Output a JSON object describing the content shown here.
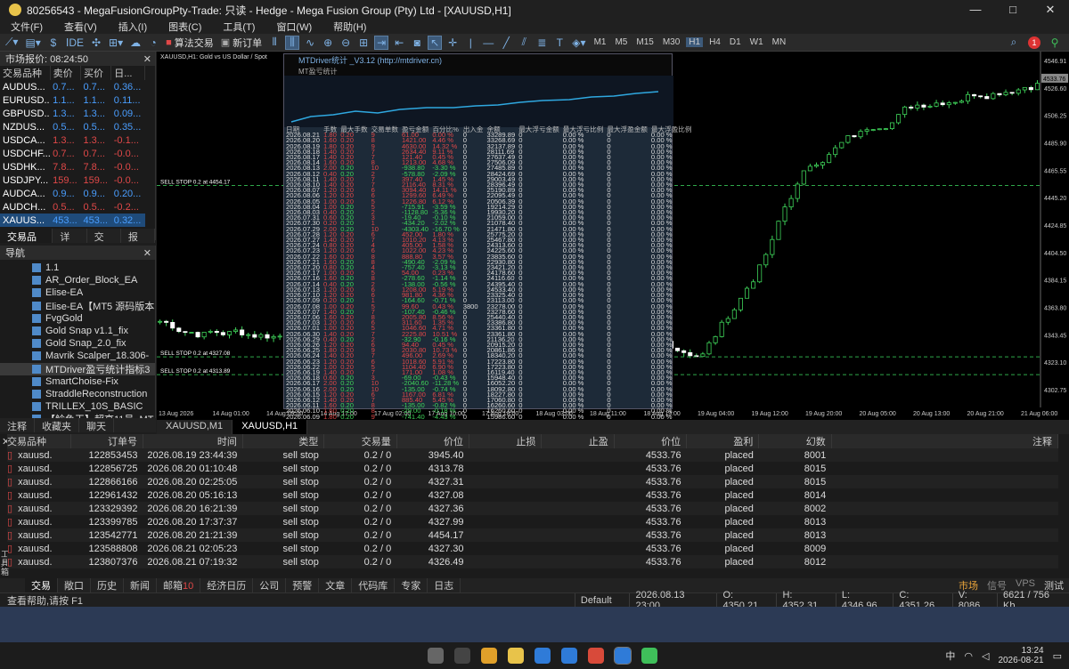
{
  "window": {
    "title": "80256543 - MegaFusionGroupPty-Trade: 只读 - Hedge - Mega Fusion Group (Pty) Ltd - [XAUUSD,H1]"
  },
  "menu": [
    "文件(F)",
    "查看(V)",
    "插入(I)",
    "图表(C)",
    "工具(T)",
    "窗口(W)",
    "帮助(H)"
  ],
  "toolbar": {
    "algo": "算法交易",
    "new_order": "新订单",
    "timeframes": [
      "M1",
      "M5",
      "M15",
      "M30",
      "H1",
      "H4",
      "D1",
      "W1",
      "MN"
    ],
    "active_tf": "H1",
    "notif": "1"
  },
  "market_watch": {
    "title": "市场报价: 08:24:50",
    "headers": [
      "交易品种",
      "卖价",
      "买价",
      "日..."
    ],
    "rows": [
      {
        "sym": "AUDUS...",
        "bid": "0.7...",
        "ask": "0.7...",
        "chg": "0.36..."
      },
      {
        "sym": "EURUSD...",
        "bid": "1.1...",
        "ask": "1.1...",
        "chg": "0.11..."
      },
      {
        "sym": "GBPUSD...",
        "bid": "1.3...",
        "ask": "1.3...",
        "chg": "0.09..."
      },
      {
        "sym": "NZDUS...",
        "bid": "0.5...",
        "ask": "0.5...",
        "chg": "0.35..."
      },
      {
        "sym": "USDCA...",
        "bid": "1.3...",
        "ask": "1.3...",
        "chg": "-0.1..."
      },
      {
        "sym": "USDCHF...",
        "bid": "0.7...",
        "ask": "0.7...",
        "chg": "-0.0..."
      },
      {
        "sym": "USDHK...",
        "bid": "7.8...",
        "ask": "7.8...",
        "chg": "-0.0..."
      },
      {
        "sym": "USDJPY...",
        "bid": "159...",
        "ask": "159...",
        "chg": "-0.0..."
      },
      {
        "sym": "AUDCA...",
        "bid": "0.9...",
        "ask": "0.9...",
        "chg": "0.20..."
      },
      {
        "sym": "AUDCH...",
        "bid": "0.5...",
        "ask": "0.5...",
        "chg": "-0.2..."
      },
      {
        "sym": "XAUUS...",
        "bid": "453...",
        "ask": "453...",
        "chg": "0.32..."
      }
    ],
    "tabs": [
      "交易品种",
      "详细",
      "交易",
      "报价"
    ]
  },
  "navigator": {
    "title": "导航",
    "items": [
      "1.1",
      "AR_Order_Block_EA",
      "Elise-EA",
      "Elise-EA【MT5 源码版本",
      "FvgGold",
      "Gold Snap v1.1_fix",
      "Gold Snap_2.0_fix",
      "Mavrik Scalper_18.306-",
      "MTDriver盈亏统计指标3",
      "SmartChoise-Fix",
      "StraddleReconstruction",
      "TRILLEX_10S_BASIC",
      "【鲶鱼王】超高11号_MT"
    ],
    "tabs": [
      "注释",
      "收藏夹",
      "聊天"
    ]
  },
  "chart": {
    "label": "XAUUSD,H1:  Gold vs US Dollar / Spot",
    "price_tag": "4533.76",
    "price_levels": [
      "4546.91",
      "4526.60",
      "4506.25",
      "4485.90",
      "4465.55",
      "4445.20",
      "4424.85",
      "4404.50",
      "4384.15",
      "4363.80",
      "4343.45",
      "4323.10",
      "4302.75"
    ],
    "time_labels": [
      "13 Aug 2026",
      "14 Aug 01:00",
      "14 Aug 09:00",
      "14 Aug 17:00",
      "17 Aug 02:00",
      "17 Aug 10:00",
      "17 Aug 18:00",
      "18 Aug 03:00",
      "18 Aug 11:00",
      "18 Aug 19:00",
      "19 Aug 04:00",
      "19 Aug 12:00",
      "19 Aug 20:00",
      "20 Aug 05:00",
      "20 Aug 13:00",
      "20 Aug 21:00",
      "21 Aug 06:00"
    ],
    "order_lines": [
      "SELL STOP 0.2 at 4454.17",
      "SELL STOP 0.2 at 4327.08",
      "SELL STOP 0.2 at 4313.89"
    ],
    "tabs": [
      "XAUUSD,M1",
      "XAUUSD,H1"
    ]
  },
  "mtdriver": {
    "title": "MTDriver统计 _V3.12 (http://mtdriver.cn)",
    "sub": "MT盈亏统计",
    "headers": [
      "日期",
      "手数",
      "最大手数",
      "交易单数",
      "盈亏金额",
      "百分比%",
      "出入金",
      "余额",
      "最大浮亏金额",
      "最大浮亏比例",
      "最大浮盈金额",
      "最大浮盈比例"
    ],
    "rows": [
      [
        "2026.08.21",
        "1.80",
        "0.20",
        "9",
        "61.00",
        "0.00 %",
        "0",
        "33289.89",
        "0",
        "0.00 %",
        "0",
        "0.00 %"
      ],
      [
        "2026.08.20",
        "1.60",
        "0.20",
        "8",
        "1421.00",
        "4.46 %",
        "0",
        "33268.69",
        "0",
        "0.00 %",
        "0",
        "0.00 %"
      ],
      [
        "2026.08.19",
        "1.80",
        "0.20",
        "9",
        "4630.00",
        "14.32 %",
        "0",
        "32137.89",
        "0",
        "0.00 %",
        "0",
        "0.00 %"
      ],
      [
        "2026.08.18",
        "1.40",
        "0.20",
        "7",
        "2634.40",
        "9.11 %",
        "0",
        "28111.69",
        "0",
        "0.00 %",
        "0",
        "0.00 %"
      ],
      [
        "2026.08.17",
        "1.40",
        "0.20",
        "7",
        "121.40",
        "0.45 %",
        "0",
        "27637.49",
        "0",
        "0.00 %",
        "0",
        "0.00 %"
      ],
      [
        "2026.08.14",
        "1.60",
        "0.20",
        "8",
        "1213.00",
        "4.68 %",
        "0",
        "27506.09",
        "0",
        "0.00 %",
        "0",
        "0.00 %"
      ],
      [
        "2026.08.13",
        "2.00",
        "0.20",
        "10",
        "-938.80",
        "-3.30 %",
        "0",
        "27485.89",
        "0",
        "0.00 %",
        "0",
        "0.00 %"
      ],
      [
        "2026.08.12",
        "0.40",
        "0.20",
        "2",
        "-578.80",
        "-2.09 %",
        "0",
        "28424.69",
        "0",
        "0.00 %",
        "0",
        "0.00 %"
      ],
      [
        "2026.08.11",
        "1.40",
        "0.20",
        "7",
        "397.40",
        "1.45 %",
        "0",
        "29003.49",
        "0",
        "0.00 %",
        "0",
        "0.00 %"
      ],
      [
        "2026.08.10",
        "1.40",
        "0.20",
        "7",
        "2116.40",
        "8.31 %",
        "0",
        "28396.49",
        "0",
        "0.00 %",
        "0",
        "0.00 %"
      ],
      [
        "2026.08.07",
        "1.20",
        "0.20",
        "6",
        "3094.40",
        "14.11 %",
        "0",
        "25190.89",
        "0",
        "0.00 %",
        "0",
        "0.00 %"
      ],
      [
        "2026.08.06",
        "1.20",
        "0.20",
        "6",
        "1299.60",
        "6.49 %",
        "0",
        "22095.49",
        "0",
        "0.00 %",
        "0",
        "0.00 %"
      ],
      [
        "2026.08.05",
        "1.00",
        "0.20",
        "5",
        "1226.80",
        "6.12 %",
        "0",
        "20506.39",
        "0",
        "0.00 %",
        "0",
        "0.00 %"
      ],
      [
        "2026.08.04",
        "1.00",
        "0.20",
        "5",
        "-715.91",
        "-3.59 %",
        "0",
        "19214.29",
        "0",
        "0.00 %",
        "0",
        "0.00 %"
      ],
      [
        "2026.08.03",
        "0.40",
        "0.20",
        "2",
        "-1128.80",
        "-5.36 %",
        "0",
        "19930.20",
        "0",
        "0.00 %",
        "0",
        "0.00 %"
      ],
      [
        "2026.07.31",
        "0.60",
        "0.20",
        "3",
        "-19.40",
        "-0.10 %",
        "0",
        "21059.00",
        "0",
        "0.00 %",
        "0",
        "0.00 %"
      ],
      [
        "2026.07.30",
        "0.20",
        "0.20",
        "1",
        "-434.20",
        "-2.02 %",
        "0",
        "21078.40",
        "0",
        "0.00 %",
        "0",
        "0.00 %"
      ],
      [
        "2026.07.29",
        "2.00",
        "0.20",
        "10",
        "-4303.40",
        "-16.70 %",
        "0",
        "21471.80",
        "0",
        "0.00 %",
        "0",
        "0.00 %"
      ],
      [
        "2026.07.28",
        "1.20",
        "0.20",
        "6",
        "452.00",
        "1.80 %",
        "0",
        "25775.20",
        "0",
        "0.00 %",
        "0",
        "0.00 %"
      ],
      [
        "2026.07.27",
        "1.40",
        "0.20",
        "7",
        "1010.20",
        "4.13 %",
        "0",
        "25467.80",
        "0",
        "0.00 %",
        "0",
        "0.00 %"
      ],
      [
        "2026.07.24",
        "0.80",
        "0.20",
        "4",
        "405.00",
        "1.58 %",
        "0",
        "24313.60",
        "0",
        "0.00 %",
        "0",
        "0.00 %"
      ],
      [
        "2026.07.23",
        "1.20",
        "0.20",
        "6",
        "1022.00",
        "4.23 %",
        "0",
        "24225.60",
        "0",
        "0.00 %",
        "0",
        "0.00 %"
      ],
      [
        "2026.07.22",
        "1.60",
        "0.20",
        "8",
        "888.80",
        "3.57 %",
        "0",
        "23835.60",
        "0",
        "0.00 %",
        "0",
        "0.00 %"
      ],
      [
        "2026.07.21",
        "1.60",
        "0.20",
        "8",
        "-490.40",
        "-2.09 %",
        "0",
        "22930.80",
        "0",
        "0.00 %",
        "0",
        "0.00 %"
      ],
      [
        "2026.07.20",
        "0.80",
        "0.20",
        "4",
        "-757.40",
        "-3.13 %",
        "0",
        "23421.20",
        "0",
        "0.00 %",
        "0",
        "0.00 %"
      ],
      [
        "2026.07.17",
        "1.00",
        "0.20",
        "5",
        "54.00",
        "0.23 %",
        "0",
        "24178.60",
        "0",
        "0.00 %",
        "0",
        "0.00 %"
      ],
      [
        "2026.07.16",
        "1.60",
        "0.20",
        "8",
        "-278.60",
        "-1.14 %",
        "0",
        "24116.60",
        "0",
        "0.00 %",
        "0",
        "0.00 %"
      ],
      [
        "2026.07.14",
        "0.40",
        "0.20",
        "2",
        "-138.00",
        "-0.56 %",
        "0",
        "24395.40",
        "0",
        "0.00 %",
        "0",
        "0.00 %"
      ],
      [
        "2026.07.13",
        "1.20",
        "0.20",
        "6",
        "1208.00",
        "5.19 %",
        "0",
        "24533.40",
        "0",
        "0.00 %",
        "0",
        "0.00 %"
      ],
      [
        "2026.07.10",
        "1.20",
        "0.20",
        "6",
        "981.80",
        "4.36 %",
        "0",
        "23325.40",
        "0",
        "0.00 %",
        "0",
        "0.00 %"
      ],
      [
        "2026.07.09",
        "0.20",
        "0.20",
        "1",
        "-164.60",
        "-0.71 %",
        "0",
        "23113.00",
        "0",
        "0.00 %",
        "0",
        "0.00 %"
      ],
      [
        "2026.07.08",
        "1.00",
        "0.20",
        "5",
        "99.60",
        "0.43 %",
        "3800",
        "23278.00",
        "0",
        "0.00 %",
        "0",
        "0.00 %"
      ],
      [
        "2026.07.07",
        "1.40",
        "0.20",
        "7",
        "-107.40",
        "-0.46 %",
        "0",
        "23278.60",
        "0",
        "0.00 %",
        "0",
        "0.00 %"
      ],
      [
        "2026.07.06",
        "1.60",
        "0.20",
        "8",
        "2005.80",
        "8.56 %",
        "0",
        "25440.40",
        "0",
        "0.00 %",
        "0",
        "0.00 %"
      ],
      [
        "2026.07.03",
        "1.20",
        "0.20",
        "6",
        "311.60",
        "1.35 %",
        "0",
        "23386.80",
        "0",
        "0.00 %",
        "0",
        "0.00 %"
      ],
      [
        "2026.07.01",
        "1.00",
        "0.20",
        "5",
        "1046.60",
        "4.71 %",
        "0",
        "23361.80",
        "0",
        "0.00 %",
        "0",
        "0.00 %"
      ],
      [
        "2026.06.30",
        "1.40",
        "0.20",
        "7",
        "2225.80",
        "10.51 %",
        "0",
        "23361.80",
        "0",
        "0.00 %",
        "0",
        "0.00 %"
      ],
      [
        "2026.06.29",
        "0.40",
        "0.20",
        "2",
        "-32.90",
        "-0.16 %",
        "0",
        "21136.20",
        "0",
        "0.00 %",
        "0",
        "0.00 %"
      ],
      [
        "2026.06.26",
        "1.20",
        "0.20",
        "6",
        "94.40",
        "0.45 %",
        "0",
        "20915.20",
        "0",
        "0.00 %",
        "0",
        "0.00 %"
      ],
      [
        "2026.06.25",
        "1.80",
        "0.20",
        "9",
        "2030.80",
        "10.73 %",
        "0",
        "20861.86",
        "0",
        "0.00 %",
        "0",
        "0.00 %"
      ],
      [
        "2026.06.24",
        "1.40",
        "0.20",
        "7",
        "496.00",
        "2.69 %",
        "0",
        "18340.20",
        "0",
        "0.00 %",
        "0",
        "0.00 %"
      ],
      [
        "2026.06.23",
        "1.20",
        "0.20",
        "6",
        "1018.60",
        "5.91 %",
        "0",
        "17223.80",
        "0",
        "0.00 %",
        "0",
        "0.00 %"
      ],
      [
        "2026.06.22",
        "1.00",
        "0.20",
        "5",
        "1104.40",
        "6.90 %",
        "0",
        "17223.80",
        "0",
        "0.00 %",
        "0",
        "0.00 %"
      ],
      [
        "2026.06.19",
        "1.40",
        "0.20",
        "7",
        "171.00",
        "1.08 %",
        "0",
        "16119.40",
        "0",
        "0.00 %",
        "0",
        "0.00 %"
      ],
      [
        "2026.06.18",
        "0.60",
        "0.20",
        "3",
        "-69.00",
        "-0.43 %",
        "0",
        "15948.40",
        "0",
        "0.00 %",
        "0",
        "0.00 %"
      ],
      [
        "2026.06.17",
        "2.00",
        "0.20",
        "10",
        "-2040.60",
        "-11.28 %",
        "0",
        "16052.20",
        "0",
        "0.00 %",
        "0",
        "0.00 %"
      ],
      [
        "2026.06.16",
        "2.00",
        "0.20",
        "10",
        "-135.00",
        "-0.74 %",
        "0",
        "18092.80",
        "0",
        "0.00 %",
        "0",
        "0.00 %"
      ],
      [
        "2026.06.15",
        "1.20",
        "0.20",
        "6",
        "1167.00",
        "6.81 %",
        "0",
        "18227.80",
        "0",
        "0.00 %",
        "0",
        "0.00 %"
      ],
      [
        "2026.06.12",
        "1.40",
        "0.20",
        "7",
        "885.40",
        "5.45 %",
        "0",
        "17060.80",
        "0",
        "0.00 %",
        "0",
        "0.00 %"
      ],
      [
        "2026.06.11",
        "1.60",
        "0.20",
        "8",
        "-135.00",
        "-0.82 %",
        "0",
        "16260.60",
        "0",
        "0.00 %",
        "0",
        "0.00 %"
      ],
      [
        "2026.06.10",
        "1.60",
        "0.20",
        "8",
        "-29.00",
        "-0.18 %",
        "0",
        "16260.60",
        "0",
        "0.00 %",
        "0",
        "0.00 %"
      ],
      [
        "2026.06.09",
        "1.80",
        "0.20",
        "9",
        "-741.40",
        "-4.43 %",
        "0",
        "15986.60",
        "0",
        "0.00 %",
        "0",
        "0.00 %"
      ]
    ]
  },
  "terminal": {
    "headers": [
      "交易品种",
      "订单号",
      "时间",
      "类型",
      "交易量",
      "价位",
      "止损",
      "止盈",
      "价位",
      "盈利",
      "幻数",
      "注释"
    ],
    "rows": [
      [
        "xauusd.",
        "122853453",
        "2026.08.19 23:44:39",
        "sell stop",
        "0.2 / 0",
        "3945.40",
        "",
        "",
        "4533.76",
        "placed",
        "8001",
        ""
      ],
      [
        "xauusd.",
        "122856725",
        "2026.08.20 01:10:48",
        "sell stop",
        "0.2 / 0",
        "4313.78",
        "",
        "",
        "4533.76",
        "placed",
        "8015",
        ""
      ],
      [
        "xauusd.",
        "122866166",
        "2026.08.20 02:25:05",
        "sell stop",
        "0.2 / 0",
        "4327.31",
        "",
        "",
        "4533.76",
        "placed",
        "8015",
        ""
      ],
      [
        "xauusd.",
        "122961432",
        "2026.08.20 05:16:13",
        "sell stop",
        "0.2 / 0",
        "4327.08",
        "",
        "",
        "4533.76",
        "placed",
        "8014",
        ""
      ],
      [
        "xauusd.",
        "123329392",
        "2026.08.20 16:21:39",
        "sell stop",
        "0.2 / 0",
        "4327.36",
        "",
        "",
        "4533.76",
        "placed",
        "8002",
        ""
      ],
      [
        "xauusd.",
        "123399785",
        "2026.08.20 17:37:37",
        "sell stop",
        "0.2 / 0",
        "4327.99",
        "",
        "",
        "4533.76",
        "placed",
        "8013",
        ""
      ],
      [
        "xauusd.",
        "123542771",
        "2026.08.20 21:21:39",
        "sell stop",
        "0.2 / 0",
        "4454.17",
        "",
        "",
        "4533.76",
        "placed",
        "8013",
        ""
      ],
      [
        "xauusd.",
        "123588808",
        "2026.08.21 02:05:23",
        "sell stop",
        "0.2 / 0",
        "4327.30",
        "",
        "",
        "4533.76",
        "placed",
        "8009",
        ""
      ],
      [
        "xauusd.",
        "123807376",
        "2026.08.21 07:19:32",
        "sell stop",
        "0.2 / 0",
        "4326.49",
        "",
        "",
        "4533.76",
        "placed",
        "8012",
        ""
      ]
    ],
    "tabs": [
      "交易",
      "敞口",
      "历史",
      "新闻",
      "邮箱",
      "经济日历",
      "公司",
      "预警",
      "文章",
      "代码库",
      "专家",
      "日志"
    ],
    "mail_badge": "10",
    "right": [
      "市场",
      "信号",
      "VPS",
      "测试"
    ],
    "side_label": "工具箱"
  },
  "status": {
    "help": "查看帮助,请按 F1",
    "profile": "Default",
    "time": "2026.08.13 23:00",
    "open": "O: 4350.21",
    "high": "H: 4352.31",
    "low": "L: 4346.96",
    "close": "C: 4351.26",
    "volume": "V: 8086",
    "traffic": "6621 / 756 Kb"
  },
  "taskbar": {
    "time": "13:24",
    "date": "2026-08-21",
    "ime": "中"
  }
}
